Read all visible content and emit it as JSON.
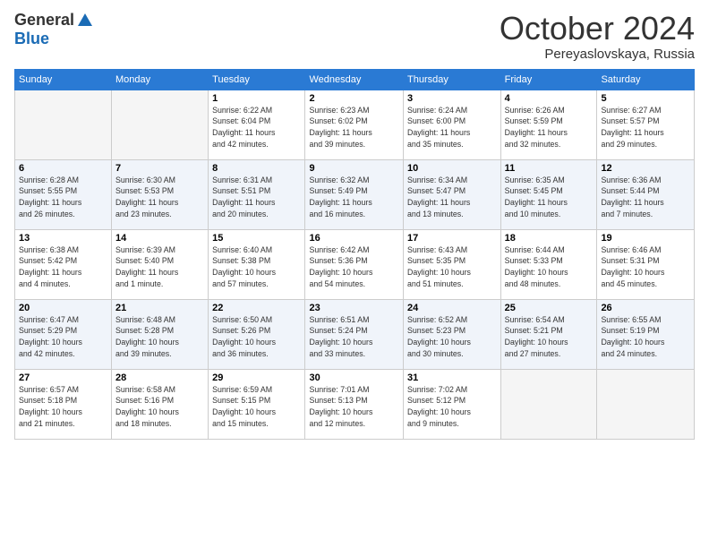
{
  "logo": {
    "general": "General",
    "blue": "Blue"
  },
  "title": "October 2024",
  "location": "Pereyaslovskaya, Russia",
  "days_of_week": [
    "Sunday",
    "Monday",
    "Tuesday",
    "Wednesday",
    "Thursday",
    "Friday",
    "Saturday"
  ],
  "weeks": [
    [
      {
        "day": "",
        "info": ""
      },
      {
        "day": "",
        "info": ""
      },
      {
        "day": "1",
        "info": "Sunrise: 6:22 AM\nSunset: 6:04 PM\nDaylight: 11 hours\nand 42 minutes."
      },
      {
        "day": "2",
        "info": "Sunrise: 6:23 AM\nSunset: 6:02 PM\nDaylight: 11 hours\nand 39 minutes."
      },
      {
        "day": "3",
        "info": "Sunrise: 6:24 AM\nSunset: 6:00 PM\nDaylight: 11 hours\nand 35 minutes."
      },
      {
        "day": "4",
        "info": "Sunrise: 6:26 AM\nSunset: 5:59 PM\nDaylight: 11 hours\nand 32 minutes."
      },
      {
        "day": "5",
        "info": "Sunrise: 6:27 AM\nSunset: 5:57 PM\nDaylight: 11 hours\nand 29 minutes."
      }
    ],
    [
      {
        "day": "6",
        "info": "Sunrise: 6:28 AM\nSunset: 5:55 PM\nDaylight: 11 hours\nand 26 minutes."
      },
      {
        "day": "7",
        "info": "Sunrise: 6:30 AM\nSunset: 5:53 PM\nDaylight: 11 hours\nand 23 minutes."
      },
      {
        "day": "8",
        "info": "Sunrise: 6:31 AM\nSunset: 5:51 PM\nDaylight: 11 hours\nand 20 minutes."
      },
      {
        "day": "9",
        "info": "Sunrise: 6:32 AM\nSunset: 5:49 PM\nDaylight: 11 hours\nand 16 minutes."
      },
      {
        "day": "10",
        "info": "Sunrise: 6:34 AM\nSunset: 5:47 PM\nDaylight: 11 hours\nand 13 minutes."
      },
      {
        "day": "11",
        "info": "Sunrise: 6:35 AM\nSunset: 5:45 PM\nDaylight: 11 hours\nand 10 minutes."
      },
      {
        "day": "12",
        "info": "Sunrise: 6:36 AM\nSunset: 5:44 PM\nDaylight: 11 hours\nand 7 minutes."
      }
    ],
    [
      {
        "day": "13",
        "info": "Sunrise: 6:38 AM\nSunset: 5:42 PM\nDaylight: 11 hours\nand 4 minutes."
      },
      {
        "day": "14",
        "info": "Sunrise: 6:39 AM\nSunset: 5:40 PM\nDaylight: 11 hours\nand 1 minute."
      },
      {
        "day": "15",
        "info": "Sunrise: 6:40 AM\nSunset: 5:38 PM\nDaylight: 10 hours\nand 57 minutes."
      },
      {
        "day": "16",
        "info": "Sunrise: 6:42 AM\nSunset: 5:36 PM\nDaylight: 10 hours\nand 54 minutes."
      },
      {
        "day": "17",
        "info": "Sunrise: 6:43 AM\nSunset: 5:35 PM\nDaylight: 10 hours\nand 51 minutes."
      },
      {
        "day": "18",
        "info": "Sunrise: 6:44 AM\nSunset: 5:33 PM\nDaylight: 10 hours\nand 48 minutes."
      },
      {
        "day": "19",
        "info": "Sunrise: 6:46 AM\nSunset: 5:31 PM\nDaylight: 10 hours\nand 45 minutes."
      }
    ],
    [
      {
        "day": "20",
        "info": "Sunrise: 6:47 AM\nSunset: 5:29 PM\nDaylight: 10 hours\nand 42 minutes."
      },
      {
        "day": "21",
        "info": "Sunrise: 6:48 AM\nSunset: 5:28 PM\nDaylight: 10 hours\nand 39 minutes."
      },
      {
        "day": "22",
        "info": "Sunrise: 6:50 AM\nSunset: 5:26 PM\nDaylight: 10 hours\nand 36 minutes."
      },
      {
        "day": "23",
        "info": "Sunrise: 6:51 AM\nSunset: 5:24 PM\nDaylight: 10 hours\nand 33 minutes."
      },
      {
        "day": "24",
        "info": "Sunrise: 6:52 AM\nSunset: 5:23 PM\nDaylight: 10 hours\nand 30 minutes."
      },
      {
        "day": "25",
        "info": "Sunrise: 6:54 AM\nSunset: 5:21 PM\nDaylight: 10 hours\nand 27 minutes."
      },
      {
        "day": "26",
        "info": "Sunrise: 6:55 AM\nSunset: 5:19 PM\nDaylight: 10 hours\nand 24 minutes."
      }
    ],
    [
      {
        "day": "27",
        "info": "Sunrise: 6:57 AM\nSunset: 5:18 PM\nDaylight: 10 hours\nand 21 minutes."
      },
      {
        "day": "28",
        "info": "Sunrise: 6:58 AM\nSunset: 5:16 PM\nDaylight: 10 hours\nand 18 minutes."
      },
      {
        "day": "29",
        "info": "Sunrise: 6:59 AM\nSunset: 5:15 PM\nDaylight: 10 hours\nand 15 minutes."
      },
      {
        "day": "30",
        "info": "Sunrise: 7:01 AM\nSunset: 5:13 PM\nDaylight: 10 hours\nand 12 minutes."
      },
      {
        "day": "31",
        "info": "Sunrise: 7:02 AM\nSunset: 5:12 PM\nDaylight: 10 hours\nand 9 minutes."
      },
      {
        "day": "",
        "info": ""
      },
      {
        "day": "",
        "info": ""
      }
    ]
  ]
}
